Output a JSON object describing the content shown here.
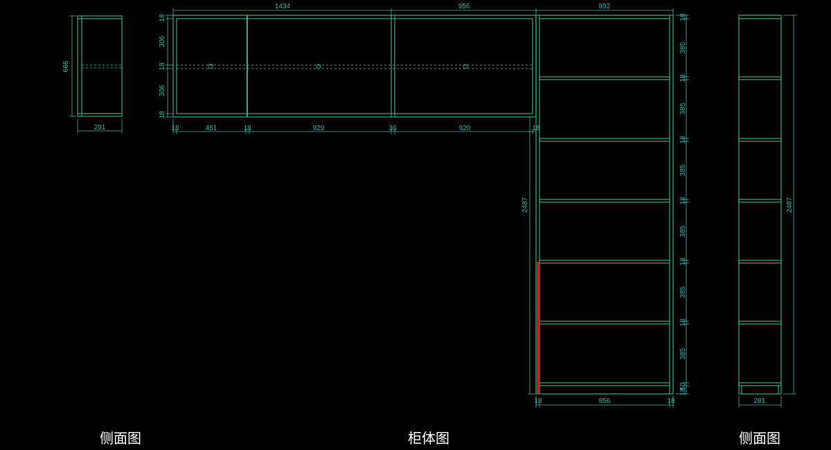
{
  "colors": {
    "line": "#2fa98a",
    "dim": "#3fb7b0",
    "red": "#c0211e",
    "background": "#000000"
  },
  "captions": {
    "left_side_view": "侧面图",
    "cabinet_view": "柜体图",
    "right_side_view": "侧面图"
  },
  "left_side": {
    "height": "666",
    "width": "291"
  },
  "upper_cabinet": {
    "top_widths": [
      "1434",
      "956",
      "892"
    ],
    "left_heights": [
      "18",
      "306",
      "18",
      "306",
      "18"
    ],
    "bottom_widths": [
      "18",
      "451",
      "18",
      "929",
      "36",
      "920",
      "18"
    ]
  },
  "tall_cabinet": {
    "overall_height": "2487",
    "right_heights": [
      "18",
      "385",
      "18",
      "385",
      "18",
      "385",
      "18",
      "385",
      "18",
      "385",
      "18",
      "385",
      "50",
      "18"
    ],
    "bottom_widths": [
      "18",
      "856",
      "18"
    ]
  },
  "right_side": {
    "height": "2487",
    "width": "281"
  }
}
